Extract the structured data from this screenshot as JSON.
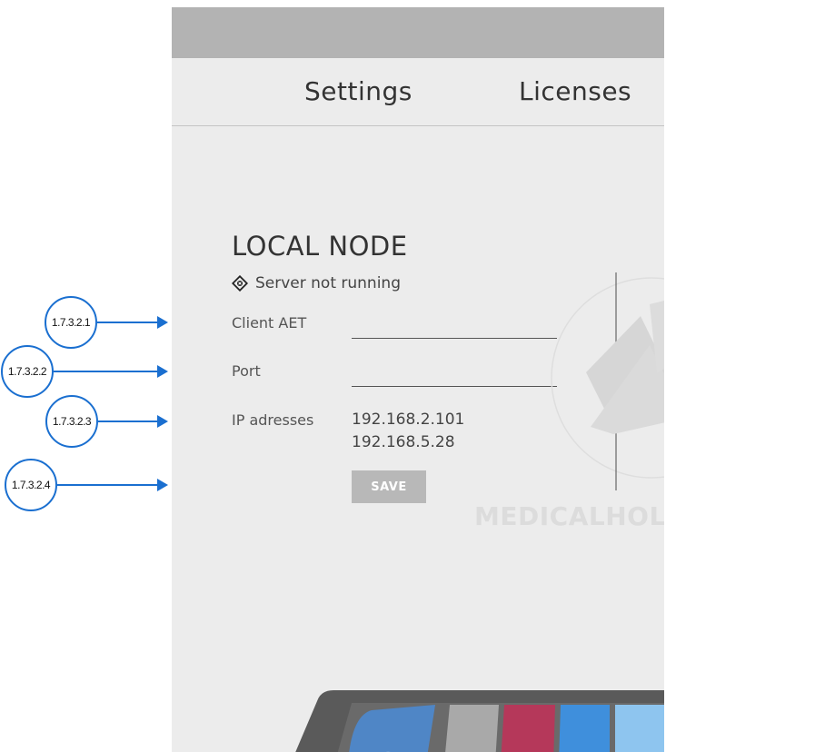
{
  "tabs": [
    {
      "label": "Settings"
    },
    {
      "label": "Licenses"
    }
  ],
  "local_node": {
    "title": "LOCAL NODE",
    "status_text": "Server not running",
    "status_icon": "stop-diamond-icon",
    "client_aet": {
      "label": "Client AET",
      "value": ""
    },
    "port": {
      "label": "Port",
      "value": ""
    },
    "ip": {
      "label": "IP adresses",
      "addresses": [
        "192.168.2.101",
        "192.168.5.28"
      ]
    },
    "save_label": "SAVE"
  },
  "brand": {
    "wordmark": "MEDICALHOLO",
    "logo_icon": "medicalholodeck-logo"
  },
  "annotations": [
    "1.7.3.2.1",
    "1.7.3.2.2",
    "1.7.3.2.3",
    "1.7.3.2.4"
  ],
  "colors": {
    "accent": "#1a6fd0",
    "panel_bg": "#ececec",
    "topbar": "#b3b3b3",
    "save_button": "#b8b8b8",
    "dock_tiles": [
      "#4f86c6",
      "#a9a9a9",
      "#b5385a",
      "#3f8fdc",
      "#8ec5ef"
    ]
  }
}
